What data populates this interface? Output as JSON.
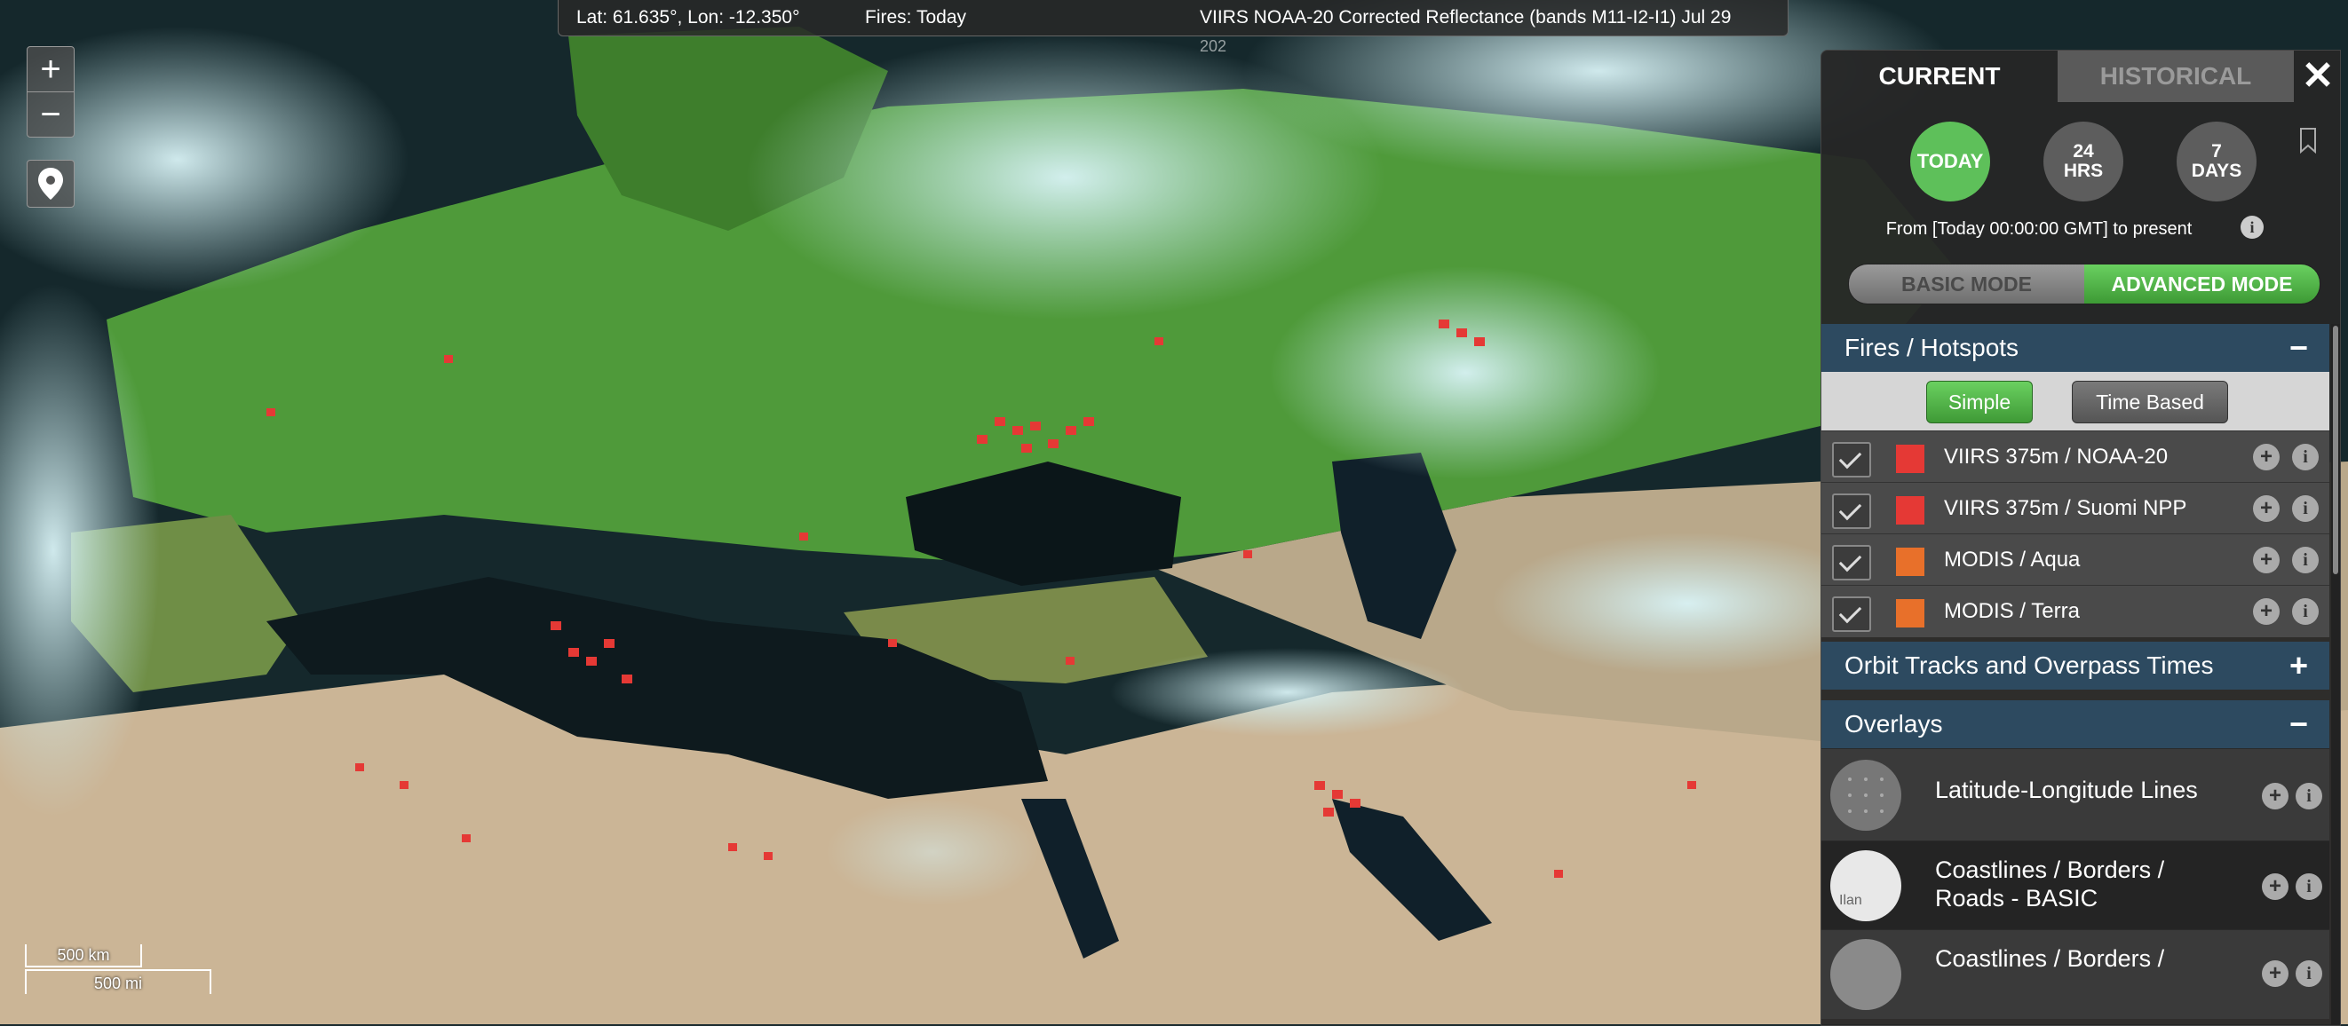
{
  "infobar": {
    "coords": "Lat: 61.635°, Lon: -12.350°",
    "fires": "Fires: Today",
    "layer": "VIIRS NOAA-20 Corrected Reflectance (bands M11-I2-I1) Jul 29",
    "year": "202"
  },
  "map_controls": {
    "zoom_in": "+",
    "zoom_out": "−"
  },
  "scale": {
    "km": "500 km",
    "mi": "500 mi"
  },
  "panel": {
    "tabs": {
      "current": "CURRENT",
      "historical": "HISTORICAL"
    },
    "close": "✕",
    "ranges": {
      "today": "TODAY",
      "hrs24": "24\nHRS",
      "days7": "7\nDAYS"
    },
    "range_text": "From [Today 00:00:00 GMT] to present",
    "info_glyph": "i",
    "modes": {
      "basic": "BASIC MODE",
      "advanced": "ADVANCED MODE"
    },
    "fires_section": {
      "title": "Fires / Hotspots",
      "toggle": "−",
      "buttons": {
        "simple": "Simple",
        "time_based": "Time Based"
      },
      "layers": [
        {
          "label": "VIIRS 375m / NOAA-20",
          "color": "#e53935"
        },
        {
          "label": "VIIRS 375m / Suomi NPP",
          "color": "#e53935"
        },
        {
          "label": "MODIS / Aqua",
          "color": "#e8702a"
        },
        {
          "label": "MODIS / Terra",
          "color": "#e8702a"
        }
      ]
    },
    "orbit_section": {
      "title": "Orbit Tracks and Overpass Times",
      "toggle": "+"
    },
    "overlays_section": {
      "title": "Overlays",
      "toggle": "−",
      "items": [
        {
          "label": "Latitude-Longitude Lines"
        },
        {
          "label": "Coastlines / Borders / Roads - BASIC",
          "thumb_text": "Ilan"
        },
        {
          "label": "Coastlines / Borders /"
        }
      ]
    }
  },
  "colors": {
    "fire_red": "#e53935",
    "accent_green": "#5ec05a",
    "section_blue": "#2d4a60"
  }
}
